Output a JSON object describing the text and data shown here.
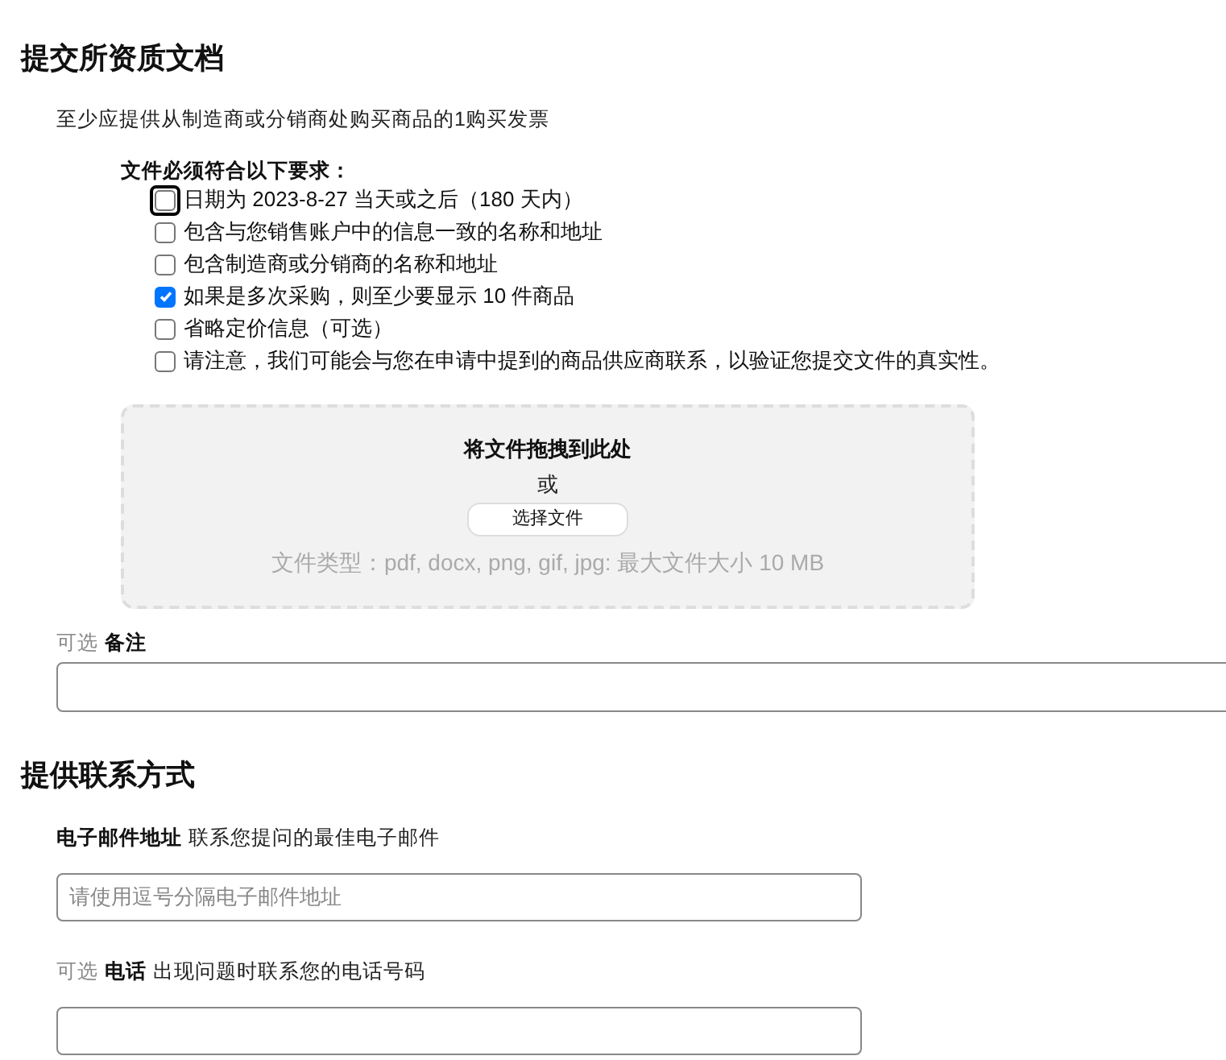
{
  "documents_section": {
    "title": "提交所资质文档",
    "intro": "至少应提供从制造商或分销商处购买商品的1购买发票",
    "requirements_title": "文件必须符合以下要求：",
    "requirements": [
      {
        "label": "日期为 2023-8-27 当天或之后（180 天内）",
        "checked": false,
        "focused": true
      },
      {
        "label": "包含与您销售账户中的信息一致的名称和地址",
        "checked": false,
        "focused": false
      },
      {
        "label": "包含制造商或分销商的名称和地址",
        "checked": false,
        "focused": false
      },
      {
        "label": "如果是多次采购，则至少要显示 10 件商品",
        "checked": true,
        "focused": false
      },
      {
        "label": "省略定价信息（可选）",
        "checked": false,
        "focused": false
      },
      {
        "label": "请注意，我们可能会与您在申请中提到的商品供应商联系，以验证您提交文件的真实性。",
        "checked": false,
        "focused": false
      }
    ],
    "dropzone": {
      "title": "将文件拖拽到此处",
      "or": "或",
      "button": "选择文件",
      "hint": "文件类型：pdf, docx, png, gif, jpg: 最大文件大小 10 MB"
    },
    "notes": {
      "optional_label": "可选",
      "label": "备注"
    }
  },
  "contact_section": {
    "title": "提供联系方式",
    "fields": [
      {
        "label": "电子邮件地址",
        "description": "联系您提问的最佳电子邮件",
        "placeholder": "请使用逗号分隔电子邮件地址"
      },
      {
        "optional_label": "可选",
        "label": "电话",
        "description": "出现问题时联系您的电话号码"
      }
    ]
  }
}
